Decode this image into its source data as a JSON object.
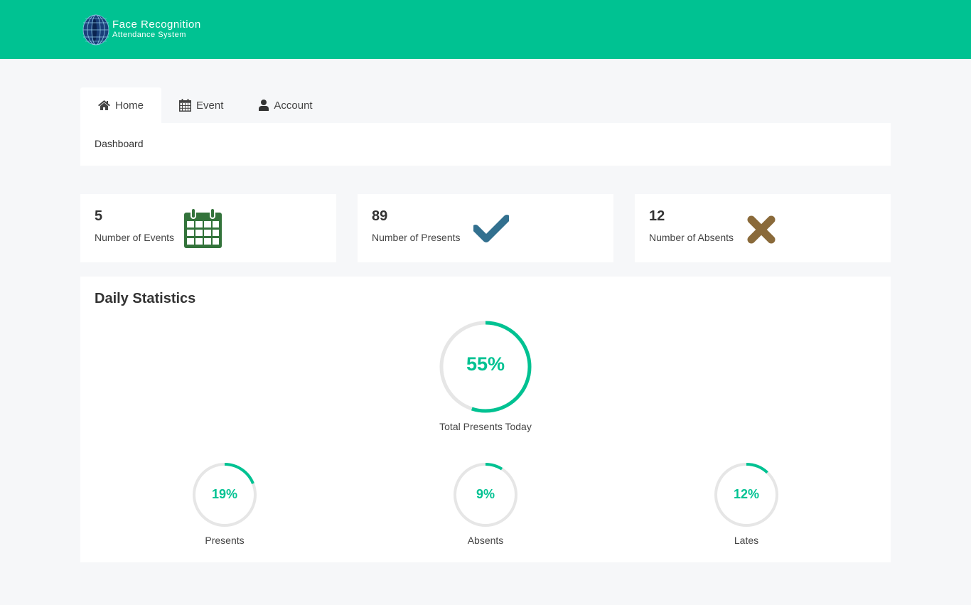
{
  "header": {
    "logo_line1": "Face Recognition",
    "logo_line2": "Attendance System",
    "bg_color": "#00c292"
  },
  "tabs": [
    {
      "label": "Home",
      "icon": "home-icon",
      "active": true
    },
    {
      "label": "Event",
      "icon": "calendar-icon",
      "active": false
    },
    {
      "label": "Account",
      "icon": "user-icon",
      "active": false
    }
  ],
  "breadcrumb": "Dashboard",
  "cards": [
    {
      "value": "5",
      "label": "Number of Events",
      "icon": "calendar-icon",
      "color": "#33733b"
    },
    {
      "value": "89",
      "label": "Number of Presents",
      "icon": "check-icon",
      "color": "#32708f"
    },
    {
      "value": "12",
      "label": "Number of Absents",
      "icon": "close-icon",
      "color": "#8a6a3a"
    }
  ],
  "daily_stats": {
    "title": "Daily Statistics",
    "accent_color": "#00c292",
    "track_color": "#e6e6e6",
    "total": {
      "percent": 55,
      "text": "55%",
      "label": "Total Presents Today"
    },
    "items": [
      {
        "percent": 19,
        "text": "19%",
        "label": "Presents"
      },
      {
        "percent": 9,
        "text": "9%",
        "label": "Absents"
      },
      {
        "percent": 12,
        "text": "12%",
        "label": "Lates"
      }
    ]
  }
}
